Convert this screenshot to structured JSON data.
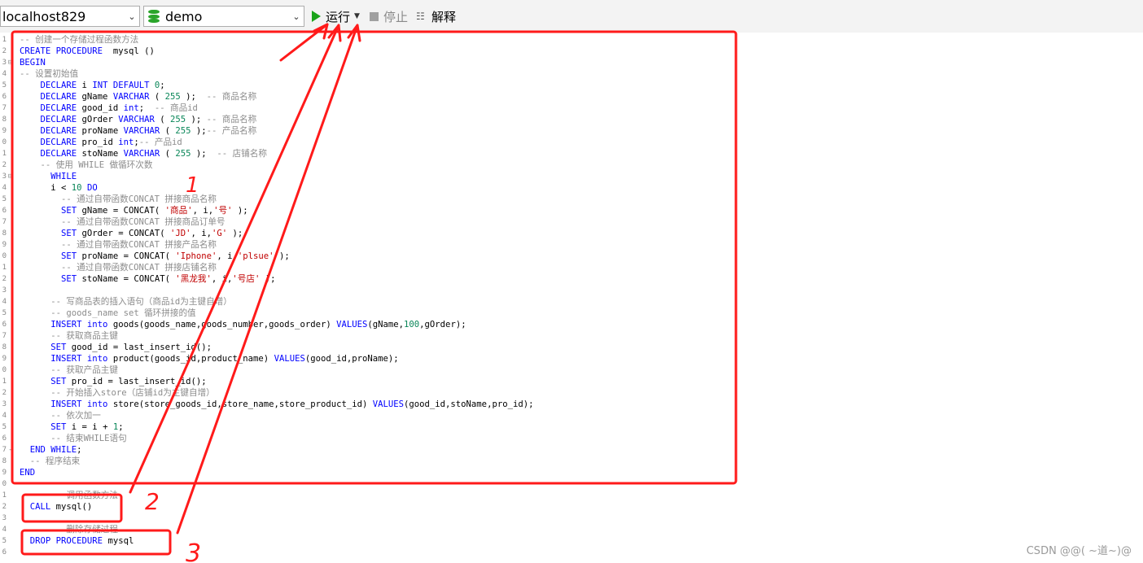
{
  "toolbar": {
    "connection": "localhost829",
    "database": "demo",
    "run_label": "运行",
    "stop_label": "停止",
    "explain_label": "解释"
  },
  "editor": {
    "lines": [
      {
        "n": "1",
        "fold": "",
        "tokens": [
          [
            "cm",
            "-- 创建一个存储过程函数方法"
          ]
        ]
      },
      {
        "n": "2",
        "fold": "",
        "tokens": [
          [
            "kw",
            "CREATE PROCEDURE"
          ],
          [
            "",
            "  mysql ()"
          ]
        ]
      },
      {
        "n": "3",
        "fold": "⊟",
        "tokens": [
          [
            "kw",
            "BEGIN"
          ]
        ]
      },
      {
        "n": "4",
        "fold": "",
        "tokens": [
          [
            "cm",
            "-- 设置初始值"
          ]
        ]
      },
      {
        "n": "5",
        "fold": "",
        "tokens": [
          [
            "",
            "    "
          ],
          [
            "kw",
            "DECLARE"
          ],
          [
            "",
            " i "
          ],
          [
            "kw",
            "INT DEFAULT"
          ],
          [
            "",
            " "
          ],
          [
            "num",
            "0"
          ],
          [
            "",
            ";"
          ]
        ]
      },
      {
        "n": "6",
        "fold": "",
        "tokens": [
          [
            "",
            "    "
          ],
          [
            "kw",
            "DECLARE"
          ],
          [
            "",
            " gName "
          ],
          [
            "kw",
            "VARCHAR"
          ],
          [
            "",
            " ( "
          ],
          [
            "num",
            "255"
          ],
          [
            "",
            " );  "
          ],
          [
            "cm",
            "-- 商品名称"
          ]
        ]
      },
      {
        "n": "7",
        "fold": "",
        "tokens": [
          [
            "",
            "    "
          ],
          [
            "kw",
            "DECLARE"
          ],
          [
            "",
            " good_id "
          ],
          [
            "kw",
            "int"
          ],
          [
            "",
            ";  "
          ],
          [
            "cm",
            "-- 商品id"
          ]
        ]
      },
      {
        "n": "8",
        "fold": "",
        "tokens": [
          [
            "",
            "    "
          ],
          [
            "kw",
            "DECLARE"
          ],
          [
            "",
            " gOrder "
          ],
          [
            "kw",
            "VARCHAR"
          ],
          [
            "",
            " ( "
          ],
          [
            "num",
            "255"
          ],
          [
            "",
            " ); "
          ],
          [
            "cm",
            "-- 商品名称"
          ]
        ]
      },
      {
        "n": "9",
        "fold": "",
        "tokens": [
          [
            "",
            "    "
          ],
          [
            "kw",
            "DECLARE"
          ],
          [
            "",
            " proName "
          ],
          [
            "kw",
            "VARCHAR"
          ],
          [
            "",
            " ( "
          ],
          [
            "num",
            "255"
          ],
          [
            "",
            " );"
          ],
          [
            "cm",
            "-- 产品名称"
          ]
        ]
      },
      {
        "n": "0",
        "fold": "",
        "tokens": [
          [
            "",
            "    "
          ],
          [
            "kw",
            "DECLARE"
          ],
          [
            "",
            " pro_id "
          ],
          [
            "kw",
            "int"
          ],
          [
            "",
            ";"
          ],
          [
            "cm",
            "-- 产品id"
          ]
        ]
      },
      {
        "n": "1",
        "fold": "",
        "tokens": [
          [
            "",
            "    "
          ],
          [
            "kw",
            "DECLARE"
          ],
          [
            "",
            " stoName "
          ],
          [
            "kw",
            "VARCHAR"
          ],
          [
            "",
            " ( "
          ],
          [
            "num",
            "255"
          ],
          [
            "",
            " );  "
          ],
          [
            "cm",
            "-- 店铺名称"
          ]
        ]
      },
      {
        "n": "2",
        "fold": "",
        "tokens": [
          [
            "",
            "    "
          ],
          [
            "cm",
            "-- 使用 WHILE 做循环次数"
          ]
        ]
      },
      {
        "n": "3",
        "fold": "⊟",
        "tokens": [
          [
            "",
            "      "
          ],
          [
            "kw",
            "WHILE"
          ]
        ]
      },
      {
        "n": "4",
        "fold": "",
        "tokens": [
          [
            "",
            "      i < "
          ],
          [
            "num",
            "10"
          ],
          [
            "",
            " "
          ],
          [
            "kw",
            "DO"
          ]
        ]
      },
      {
        "n": "5",
        "fold": "",
        "tokens": [
          [
            "",
            "        "
          ],
          [
            "cm",
            "-- 通过自带函数CONCAT 拼接商品名称"
          ]
        ]
      },
      {
        "n": "6",
        "fold": "",
        "tokens": [
          [
            "",
            "        "
          ],
          [
            "kw",
            "SET"
          ],
          [
            "",
            " gName = CONCAT( "
          ],
          [
            "str",
            "'商品'"
          ],
          [
            "",
            ", i,"
          ],
          [
            "str",
            "'号'"
          ],
          [
            "",
            " );"
          ]
        ]
      },
      {
        "n": "7",
        "fold": "",
        "tokens": [
          [
            "",
            "        "
          ],
          [
            "cm",
            "-- 通过自带函数CONCAT 拼接商品订单号"
          ]
        ]
      },
      {
        "n": "8",
        "fold": "",
        "tokens": [
          [
            "",
            "        "
          ],
          [
            "kw",
            "SET"
          ],
          [
            "",
            " gOrder = CONCAT( "
          ],
          [
            "str",
            "'JD'"
          ],
          [
            "",
            ", i,"
          ],
          [
            "str",
            "'G'"
          ],
          [
            "",
            " );"
          ]
        ]
      },
      {
        "n": "9",
        "fold": "",
        "tokens": [
          [
            "",
            "        "
          ],
          [
            "cm",
            "-- 通过自带函数CONCAT 拼接产品名称"
          ]
        ]
      },
      {
        "n": "0",
        "fold": "",
        "tokens": [
          [
            "",
            "        "
          ],
          [
            "kw",
            "SET"
          ],
          [
            "",
            " proName = CONCAT( "
          ],
          [
            "str",
            "'Iphone'"
          ],
          [
            "",
            ", i,"
          ],
          [
            "str",
            "'plsue'"
          ],
          [
            "",
            " );"
          ]
        ]
      },
      {
        "n": "1",
        "fold": "",
        "tokens": [
          [
            "",
            "        "
          ],
          [
            "cm",
            "-- 通过自带函数CONCAT 拼接店铺名称"
          ]
        ]
      },
      {
        "n": "2",
        "fold": "",
        "tokens": [
          [
            "",
            "        "
          ],
          [
            "kw",
            "SET"
          ],
          [
            "",
            " stoName = CONCAT( "
          ],
          [
            "str",
            "'黑龙我'"
          ],
          [
            "",
            ", i,"
          ],
          [
            "str",
            "'号店'"
          ],
          [
            "",
            " );"
          ]
        ]
      },
      {
        "n": "3",
        "fold": "",
        "tokens": []
      },
      {
        "n": "4",
        "fold": "",
        "tokens": [
          [
            "",
            "      "
          ],
          [
            "cm",
            "-- 写商品表的插入语句（商品id为主键自增）"
          ]
        ]
      },
      {
        "n": "5",
        "fold": "",
        "tokens": [
          [
            "",
            "      "
          ],
          [
            "cm",
            "-- goods_name set 循环拼接的值"
          ]
        ]
      },
      {
        "n": "6",
        "fold": "",
        "tokens": [
          [
            "",
            "      "
          ],
          [
            "kw",
            "INSERT into"
          ],
          [
            "",
            " goods(goods_name,goods_number,goods_order) "
          ],
          [
            "kw",
            "VALUES"
          ],
          [
            "",
            "(gName,"
          ],
          [
            "num",
            "100"
          ],
          [
            "",
            ",gOrder);"
          ]
        ]
      },
      {
        "n": "7",
        "fold": "",
        "tokens": [
          [
            "",
            "      "
          ],
          [
            "cm",
            "-- 获取商品主键"
          ]
        ]
      },
      {
        "n": "8",
        "fold": "",
        "tokens": [
          [
            "",
            "      "
          ],
          [
            "kw",
            "SET"
          ],
          [
            "",
            " good_id = last_insert_id();"
          ]
        ]
      },
      {
        "n": "9",
        "fold": "",
        "tokens": [
          [
            "",
            "      "
          ],
          [
            "kw",
            "INSERT into"
          ],
          [
            "",
            " product(goods_id,product_name) "
          ],
          [
            "kw",
            "VALUES"
          ],
          [
            "",
            "(good_id,proName);"
          ]
        ]
      },
      {
        "n": "0",
        "fold": "",
        "tokens": [
          [
            "",
            "      "
          ],
          [
            "cm",
            "-- 获取产品主键"
          ]
        ]
      },
      {
        "n": "1",
        "fold": "",
        "tokens": [
          [
            "",
            "      "
          ],
          [
            "kw",
            "SET"
          ],
          [
            "",
            " pro_id = last_insert_id();"
          ]
        ]
      },
      {
        "n": "2",
        "fold": "",
        "tokens": [
          [
            "",
            "      "
          ],
          [
            "cm",
            "-- 开始插入store（店铺id为主键自增）"
          ]
        ]
      },
      {
        "n": "3",
        "fold": "",
        "tokens": [
          [
            "",
            "      "
          ],
          [
            "kw",
            "INSERT into"
          ],
          [
            "",
            " store(store_goods_id,store_name,store_product_id) "
          ],
          [
            "kw",
            "VALUES"
          ],
          [
            "",
            "(good_id,stoName,pro_id);"
          ]
        ]
      },
      {
        "n": "4",
        "fold": "",
        "tokens": [
          [
            "",
            "      "
          ],
          [
            "cm",
            "-- 依次加一"
          ]
        ]
      },
      {
        "n": "5",
        "fold": "",
        "tokens": [
          [
            "",
            "      "
          ],
          [
            "kw",
            "SET"
          ],
          [
            "",
            " i = i + "
          ],
          [
            "num",
            "1"
          ],
          [
            "",
            ";"
          ]
        ]
      },
      {
        "n": "6",
        "fold": "",
        "tokens": [
          [
            "",
            "      "
          ],
          [
            "cm",
            "-- 结束WHILE语句"
          ]
        ]
      },
      {
        "n": "7",
        "fold": "-",
        "tokens": [
          [
            "",
            "  "
          ],
          [
            "kw",
            "END WHILE"
          ],
          [
            "",
            ";"
          ]
        ]
      },
      {
        "n": "8",
        "fold": "",
        "tokens": [
          [
            "",
            "  "
          ],
          [
            "cm",
            "-- 程序结束"
          ]
        ]
      },
      {
        "n": "9",
        "fold": "",
        "tokens": [
          [
            "kw",
            "END"
          ]
        ]
      },
      {
        "n": "0",
        "fold": "",
        "tokens": []
      },
      {
        "n": "1",
        "fold": "",
        "tokens": [
          [
            "",
            "      "
          ],
          [
            "cm",
            "-- 调用函数方法"
          ]
        ]
      },
      {
        "n": "2",
        "fold": "",
        "tokens": [
          [
            "",
            "  "
          ],
          [
            "kw",
            "CALL"
          ],
          [
            "",
            " mysql()"
          ]
        ]
      },
      {
        "n": "3",
        "fold": "",
        "tokens": []
      },
      {
        "n": "4",
        "fold": "",
        "tokens": [
          [
            "",
            "      "
          ],
          [
            "cm",
            "-- 删除存储过程"
          ]
        ]
      },
      {
        "n": "5",
        "fold": "",
        "tokens": [
          [
            "",
            "  "
          ],
          [
            "kw",
            "DROP PROCEDURE"
          ],
          [
            "",
            " mysql"
          ]
        ]
      },
      {
        "n": "6",
        "fold": "",
        "tokens": []
      }
    ]
  },
  "annotations": {
    "mark_1": "1",
    "mark_2": "2",
    "mark_3": "3",
    "ink_color": "#ff1a1a"
  },
  "watermark": "CSDN @@( ~道~)@"
}
